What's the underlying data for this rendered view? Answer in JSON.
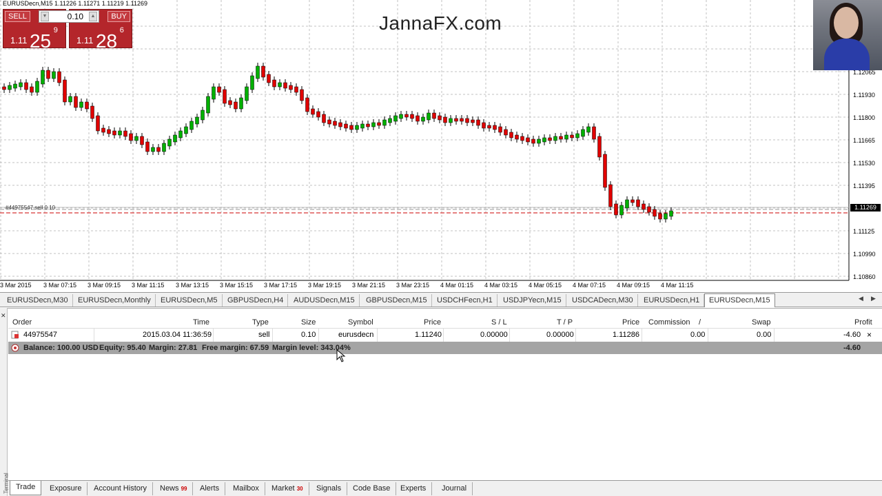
{
  "chart": {
    "title": "EURUSDecn,M15  1.11226 1.11271 1.11219 1.11269",
    "watermark": "JannaFX.com",
    "order_line_label": "#44975547 sell 0.10",
    "current_price": "1.11269",
    "price_axis": [
      "1.12065",
      "1.11930",
      "1.11800",
      "1.11665",
      "1.11530",
      "1.11395",
      "1.11125",
      "1.10990",
      "1.10860"
    ],
    "time_axis": [
      "3 Mar 2015",
      "3 Mar 07:15",
      "3 Mar 09:15",
      "3 Mar 11:15",
      "3 Mar 13:15",
      "3 Mar 15:15",
      "3 Mar 17:15",
      "3 Mar 19:15",
      "3 Mar 21:15",
      "3 Mar 23:15",
      "4 Mar 01:15",
      "4 Mar 03:15",
      "4 Mar 05:15",
      "4 Mar 07:15",
      "4 Mar 09:15",
      "4 Mar 11:15"
    ],
    "bull_color": "#00b000",
    "bear_color": "#e00000",
    "grid_color": "#c0c0c0"
  },
  "one_click": {
    "sell_label": "SELL",
    "buy_label": "BUY",
    "lot": "0.10",
    "sell_prefix": "1.11",
    "sell_big": "25",
    "sell_sup": "9",
    "buy_prefix": "1.11",
    "buy_big": "28",
    "buy_sup": "6"
  },
  "chart_tabs": [
    "EURUSDecn,M30",
    "EURUSDecn,Monthly",
    "EURUSDecn,M5",
    "GBPUSDecn,H4",
    "AUDUSDecn,M15",
    "GBPUSDecn,M15",
    "USDCHFecn,H1",
    "USDJPYecn,M15",
    "USDCADecn,M30",
    "EURUSDecn,H1",
    "EURUSDecn,M15"
  ],
  "terminal": {
    "side_label": "Terminal",
    "columns": [
      "Order",
      "Time",
      "Type",
      "Size",
      "Symbol",
      "Price",
      "S / L",
      "T / P",
      "Price",
      "Commission",
      "/",
      "Swap",
      "Profit"
    ],
    "row": {
      "order": "44975547",
      "time": "2015.03.04 11:36:59",
      "type": "sell",
      "size": "0.10",
      "symbol": "eurusdecn",
      "price": "1.11240",
      "sl": "0.00000",
      "tp": "0.00000",
      "cur_price": "1.11286",
      "commission": "0.00",
      "swap": "0.00",
      "profit": "-4.60"
    },
    "balance": {
      "balance": "Balance: 100.00 USD",
      "equity": "Equity: 95.40",
      "margin": "Margin: 27.81",
      "free_margin": "Free margin: 67.59",
      "margin_level": "Margin level: 343.04%",
      "profit": "-4.60"
    }
  },
  "bottom_tabs": [
    {
      "label": "Trade",
      "count": ""
    },
    {
      "label": "Exposure",
      "count": ""
    },
    {
      "label": "Account History",
      "count": ""
    },
    {
      "label": "News",
      "count": "99"
    },
    {
      "label": "Alerts",
      "count": ""
    },
    {
      "label": "Mailbox",
      "count": ""
    },
    {
      "label": "Market",
      "count": "30"
    },
    {
      "label": "Signals",
      "count": ""
    },
    {
      "label": "Code Base",
      "count": ""
    },
    {
      "label": "Experts",
      "count": ""
    },
    {
      "label": "Journal",
      "count": ""
    }
  ]
}
